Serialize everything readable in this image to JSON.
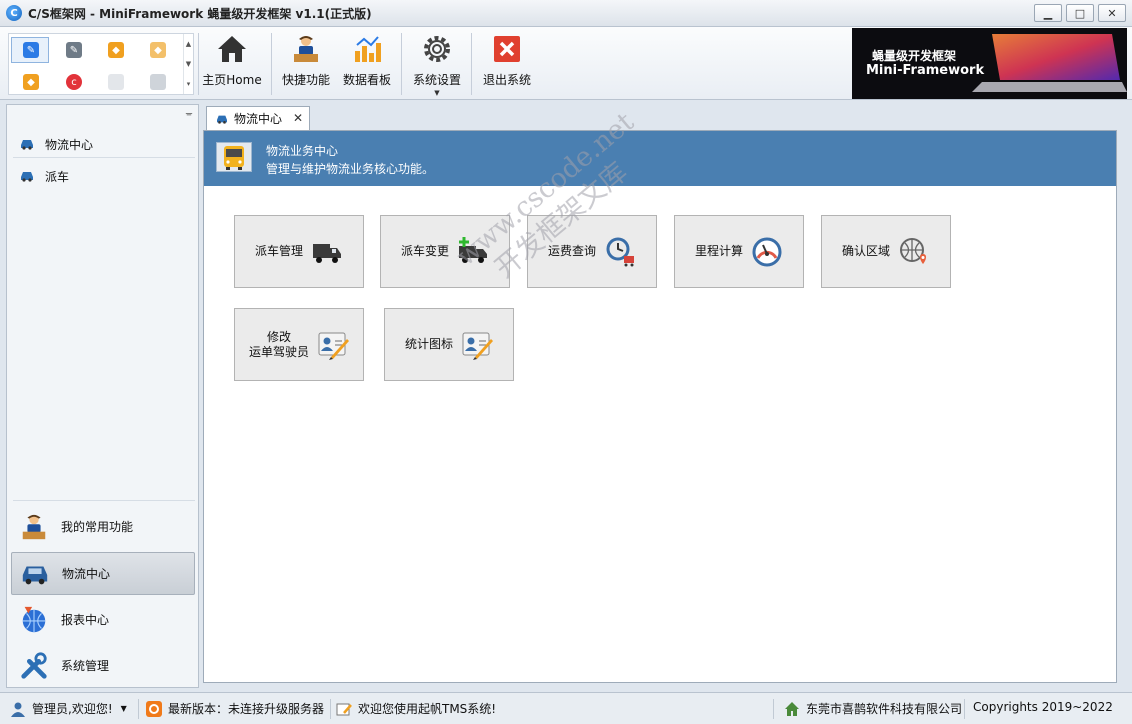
{
  "window": {
    "title": "C/S框架网 - MiniFramework 蝇量级开发框架 v1.1(正式版)",
    "min": "▁",
    "max": "□",
    "close": "✕"
  },
  "toolbar": {
    "buttons": [
      {
        "label": "主页Home",
        "icon": "home-icon"
      },
      {
        "label": "快捷功能",
        "icon": "person-desk-icon"
      },
      {
        "label": "数据看板",
        "icon": "chart-icon"
      },
      {
        "label": "系统设置",
        "icon": "gear-icon"
      },
      {
        "label": "退出系统",
        "icon": "exit-icon"
      }
    ],
    "banner": {
      "line1": "蝇量级开发框架",
      "line2": "Mini-Framework"
    }
  },
  "leftnav": {
    "items": [
      {
        "label": "物流中心",
        "icon": "car-icon"
      },
      {
        "label": "派车",
        "icon": "car-icon"
      }
    ],
    "modules": [
      {
        "label": "我的常用功能",
        "icon": "person-desk-icon",
        "active": false
      },
      {
        "label": "物流中心",
        "icon": "car-icon",
        "active": true
      },
      {
        "label": "报表中心",
        "icon": "globe-icon",
        "active": false
      },
      {
        "label": "系统管理",
        "icon": "tools-icon",
        "active": false
      }
    ]
  },
  "tab": {
    "label": "物流中心",
    "close": "✕"
  },
  "header": {
    "title": "物流业务中心",
    "subtitle": "管理与维护物流业务核心功能。"
  },
  "functions": [
    {
      "label": "派车管理",
      "icon": "truck-icon"
    },
    {
      "label": "派车变更",
      "icon": "truck-add-icon"
    },
    {
      "label": "运费查询",
      "icon": "clock-cart-icon"
    },
    {
      "label": "里程计算",
      "icon": "gauge-icon"
    },
    {
      "label": "确认区域",
      "icon": "globe-pin-icon"
    },
    {
      "label1": "修改",
      "label2": "运单驾驶员",
      "icon": "id-card-edit-icon"
    },
    {
      "label": "统计图标",
      "icon": "id-card-edit-icon"
    }
  ],
  "watermark": {
    "line1": "www.cscode.net",
    "line2": "开发框架文库"
  },
  "status": {
    "user": "管理员,欢迎您!",
    "version": "最新版本：未连接升级服务器",
    "welcome": "欢迎您使用起帆TMS系统!",
    "company": "东莞市喜鹊软件科技有限公司",
    "copyright": "Copyrights 2019~2022"
  },
  "colors": {
    "header": "#4a7fb1",
    "banner": "#0c0c10",
    "exit": "#e0402f"
  }
}
